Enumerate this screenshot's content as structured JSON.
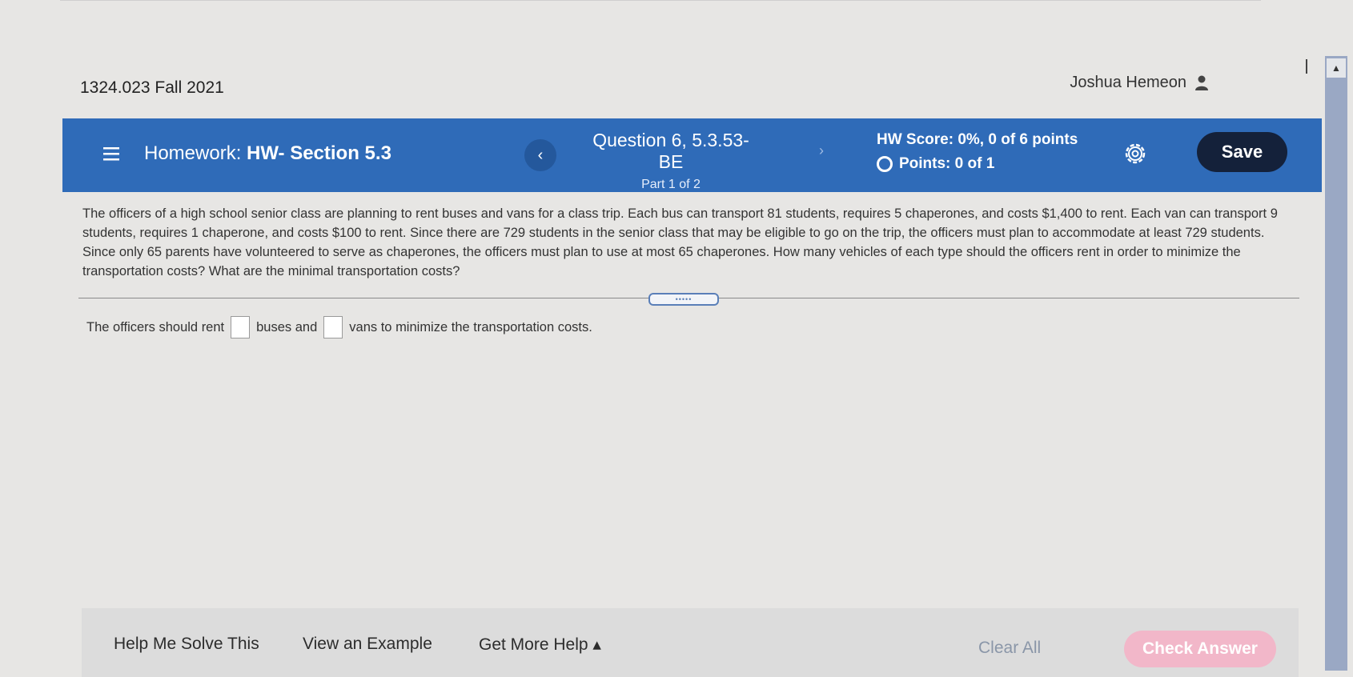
{
  "course": "1324.023 Fall 2021",
  "user": {
    "name": "Joshua Hemeon",
    "icon": "person-icon"
  },
  "header": {
    "homework_prefix": "Homework:",
    "homework_name": "HW- Section 5.3",
    "question": "Question 6, 5.3.53-BE",
    "part": "Part 1 of 2",
    "prev_glyph": "‹",
    "next_glyph": "›",
    "score": "HW Score: 0%, 0 of 6 points",
    "points": "Points: 0 of 1",
    "save": "Save",
    "color": "#2f6bb8"
  },
  "problem": "The officers of a high school senior class are planning to rent buses and vans for a class trip. Each bus can transport 81 students, requires 5 chaperones, and costs $1,400 to rent. Each van can transport 9 students, requires 1 chaperone, and costs $100 to rent. Since there are 729 students in the senior class that may be eligible to go on the trip, the officers must plan to accommodate at least 729 students. Since only 65 parents have volunteered to serve as chaperones, the officers must plan to use at most 65 chaperones. How many vehicles of each type should the officers rent in order to minimize the transportation costs? What are the minimal transportation costs?",
  "handle_label": "•••••",
  "answer": {
    "part1": "The officers should rent",
    "part2": "buses and",
    "part3": "vans to minimize the transportation costs.",
    "buses_value": "",
    "vans_value": ""
  },
  "footer": {
    "help_me_solve": "Help Me Solve This",
    "view_example": "View an Example",
    "get_more_help": "Get More Help ▴",
    "clear_all": "Clear All",
    "check_answer": "Check Answer"
  },
  "scroll_up_glyph": "▲"
}
